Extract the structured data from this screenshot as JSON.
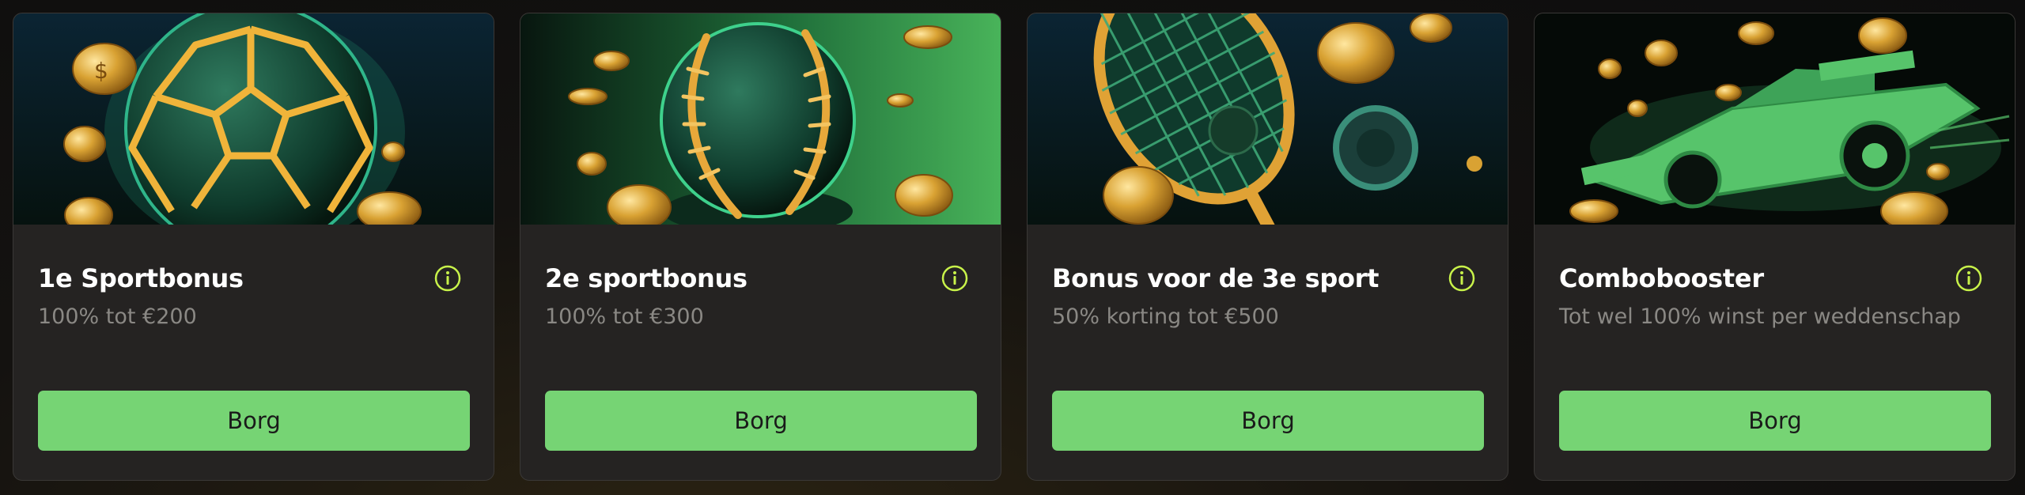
{
  "cards": [
    {
      "title": "1e Sportbonus",
      "subtitle": "100% tot €200",
      "button": "Borg",
      "image": "golden-football-with-coins",
      "info_icon": "info-circle-icon"
    },
    {
      "title": "2e sportbonus",
      "subtitle": "100% tot €300",
      "button": "Borg",
      "image": "golden-baseball-with-coins",
      "info_icon": "info-circle-icon"
    },
    {
      "title": "Bonus voor de 3e sport",
      "subtitle": "50% korting tot €500",
      "button": "Borg",
      "image": "golden-tennis-racket-with-coins",
      "info_icon": "info-circle-icon"
    },
    {
      "title": "Combobooster",
      "subtitle": "Tot wel 100% winst per weddenschap",
      "button": "Borg",
      "image": "green-race-car-with-coins",
      "info_icon": "info-circle-icon"
    }
  ],
  "colors": {
    "accent": "#76d474",
    "info_icon": "#c8f24a",
    "card_bg": "#252322",
    "subtitle": "#8a8884"
  }
}
